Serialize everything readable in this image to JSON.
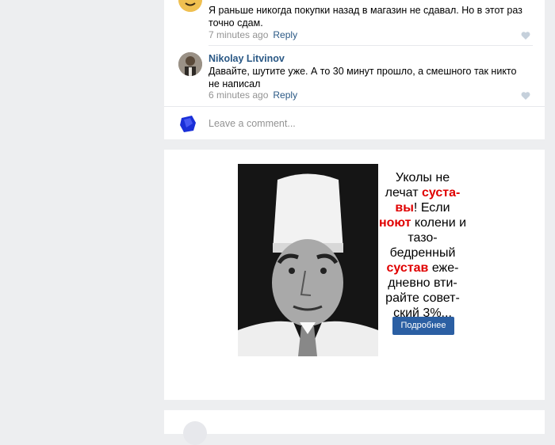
{
  "comments": [
    {
      "text": "Я раньше никогда покупки назад в магазин не сдавал. Но в этот раз точно сдам.",
      "time": "7 minutes ago",
      "reply_label": "Reply"
    },
    {
      "author": "Nikolay Litvinov",
      "text": "Давайте, шутите уже. А то 30 минут прошло, а смешного так никто не написал",
      "time": "6 minutes ago",
      "reply_label": "Reply"
    }
  ],
  "composer": {
    "placeholder": "Leave a comment..."
  },
  "ad": {
    "text_parts": {
      "p1": "Уколы не лечат ",
      "r1": "суста-вы",
      "p2": "! Если ",
      "r2": "ноют",
      "p3": " колени и тазо-бедренный ",
      "r3": "сустав",
      "p4": " еже-дневно вти-райте совет-ский 3%..."
    },
    "button_label": "Подробнее"
  }
}
